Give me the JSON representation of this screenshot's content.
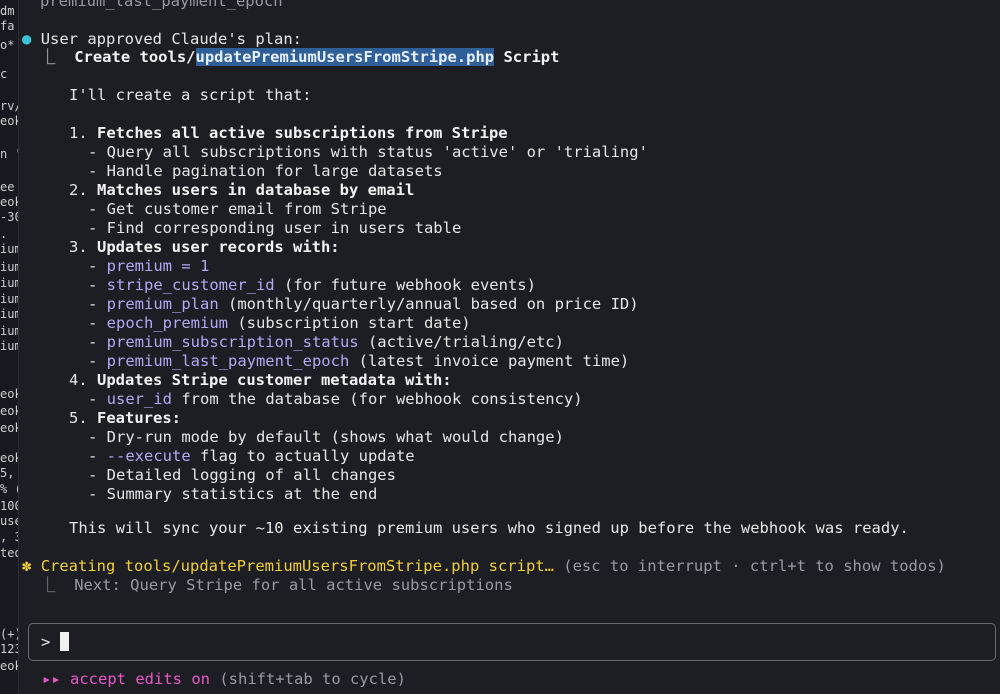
{
  "left_pane": {
    "fragments": [
      "dm",
      "fa",
      "o*",
      "c",
      "rv/",
      "eok",
      "n '",
      "ee",
      "eok",
      "-30",
      ".",
      "ium",
      "ium",
      "ium",
      "ium",
      "ium",
      "ium",
      "ium",
      "eok",
      "eok",
      "eok",
      "eok",
      "5,",
      "% (",
      "100",
      "use",
      ", 3",
      "ted",
      "(+)",
      "123",
      "eok"
    ]
  },
  "header_line": "premium_last_payment_epoch",
  "approved": {
    "bullet": "●",
    "label": "User approved Claude's plan:",
    "tree_char": "⎿",
    "create_prefix": "Create tools/",
    "create_highlight": "updatePremiumUsersFromStripe.php",
    "create_suffix": " Script"
  },
  "plan": {
    "intro": "I'll create a script that:",
    "items": [
      {
        "num": "1.",
        "title": "Fetches all active subscriptions from Stripe",
        "subs": [
          {
            "code": "",
            "text": "Query all subscriptions with status 'active' or 'trialing'"
          },
          {
            "code": "",
            "text": "Handle pagination for large datasets"
          }
        ]
      },
      {
        "num": "2.",
        "title": "Matches users in database by email",
        "subs": [
          {
            "code": "",
            "text": "Get customer email from Stripe"
          },
          {
            "code": "",
            "text": "Find corresponding user in users table"
          }
        ]
      },
      {
        "num": "3.",
        "title": "Updates user records with:",
        "subs": [
          {
            "code": "premium = 1",
            "text": ""
          },
          {
            "code": "stripe_customer_id",
            "text": " (for future webhook events)"
          },
          {
            "code": "premium_plan",
            "text": " (monthly/quarterly/annual based on price ID)"
          },
          {
            "code": "epoch_premium",
            "text": " (subscription start date)"
          },
          {
            "code": "premium_subscription_status",
            "text": " (active/trialing/etc)"
          },
          {
            "code": "premium_last_payment_epoch",
            "text": " (latest invoice payment time)"
          }
        ]
      },
      {
        "num": "4.",
        "title": "Updates Stripe customer metadata with:",
        "subs": [
          {
            "code": "user_id",
            "text": " from the database (for webhook consistency)"
          }
        ]
      },
      {
        "num": "5.",
        "title": "Features:",
        "subs": [
          {
            "code": "",
            "text": "Dry-run mode by default (shows what would change)"
          },
          {
            "code": "--execute",
            "text": " flag to actually update"
          },
          {
            "code": "",
            "text": "Detailed logging of all changes"
          },
          {
            "code": "",
            "text": "Summary statistics at the end"
          }
        ]
      }
    ],
    "summary": "This will sync your ~10 existing premium users who signed up before the webhook was ready."
  },
  "status": {
    "spinner": "✽",
    "text": "Creating tools/updatePremiumUsersFromStripe.php script…",
    "hint": " (esc to interrupt · ctrl+t to show todos)",
    "tree_char": "⎿",
    "next": "Next: Query Stripe for all active subscriptions"
  },
  "prompt": {
    "char": ">",
    "value": ""
  },
  "footer": {
    "arrows": "▸▸",
    "mode": "accept edits on",
    "hint": " (shift+tab to cycle)"
  },
  "colors": {
    "background": "#1d1e24",
    "accent_purple": "#b4a8f5",
    "selection": "#2f5f99",
    "bullet_cyan": "#38c4d8",
    "spinner_yellow": "#f2cf3a",
    "mode_pink": "#ea57c9"
  }
}
